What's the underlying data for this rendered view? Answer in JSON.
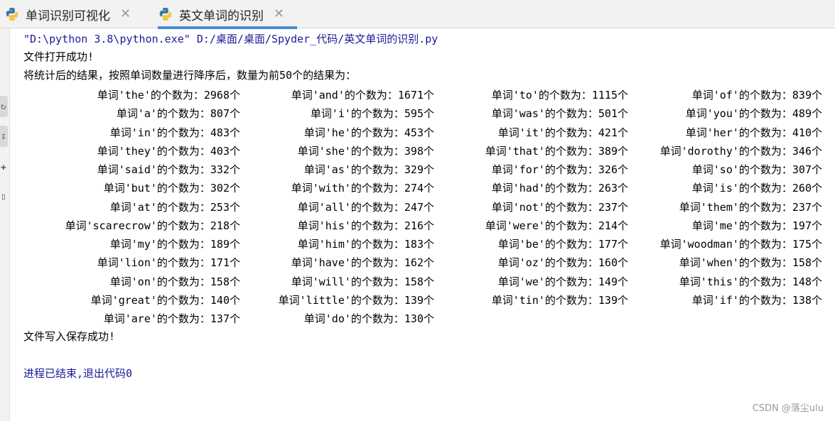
{
  "tabs": [
    {
      "label": "单词识别可视化",
      "active": false
    },
    {
      "label": "英文单词的识别",
      "active": true
    }
  ],
  "console": {
    "command": "\"D:\\python 3.8\\python.exe\" D:/桌面/桌面/Spyder_代码/英文单词的识别.py",
    "open_success": "文件打开成功!",
    "intro": "将统计后的结果，按照单词数量进行降序后，数量为前50个的结果为：",
    "results": [
      [
        "单词'the'的个数为：2968个",
        "单词'and'的个数为：1671个",
        "单词'to'的个数为：1115个",
        "单词'of'的个数为：839个"
      ],
      [
        "单词'a'的个数为：807个",
        "单词'i'的个数为：595个",
        "单词'was'的个数为：501个",
        "单词'you'的个数为：489个"
      ],
      [
        "单词'in'的个数为：483个",
        "单词'he'的个数为：453个",
        "单词'it'的个数为：421个",
        "单词'her'的个数为：410个"
      ],
      [
        "单词'they'的个数为：403个",
        "单词'she'的个数为：398个",
        "单词'that'的个数为：389个",
        "单词'dorothy'的个数为：346个"
      ],
      [
        "单词'said'的个数为：332个",
        "单词'as'的个数为：329个",
        "单词'for'的个数为：326个",
        "单词'so'的个数为：307个"
      ],
      [
        "单词'but'的个数为：302个",
        "单词'with'的个数为：274个",
        "单词'had'的个数为：263个",
        "单词'is'的个数为：260个"
      ],
      [
        "单词'at'的个数为：253个",
        "单词'all'的个数为：247个",
        "单词'not'的个数为：237个",
        "单词'them'的个数为：237个"
      ],
      [
        "单词'scarecrow'的个数为：218个",
        "单词'his'的个数为：216个",
        "单词'were'的个数为：214个",
        "单词'me'的个数为：197个"
      ],
      [
        "单词'my'的个数为：189个",
        "单词'him'的个数为：183个",
        "单词'be'的个数为：177个",
        "单词'woodman'的个数为：175个"
      ],
      [
        "单词'lion'的个数为：171个",
        "单词'have'的个数为：162个",
        "单词'oz'的个数为：160个",
        "单词'when'的个数为：158个"
      ],
      [
        "单词'on'的个数为：158个",
        "单词'will'的个数为：158个",
        "单词'we'的个数为：149个",
        "单词'this'的个数为：148个"
      ],
      [
        "单词'great'的个数为：140个",
        "单词'little'的个数为：139个",
        "单词'tin'的个数为：139个",
        "单词'if'的个数为：138个"
      ],
      [
        "单词'are'的个数为：137个",
        "单词'do'的个数为：130个",
        "",
        ""
      ]
    ],
    "save_success": "文件写入保存成功!",
    "exit_message": "进程已结束,退出代码0"
  },
  "watermark": "CSDN @落尘ulu",
  "icons": {
    "tab_icon": "python-icon",
    "close": "close-icon"
  }
}
